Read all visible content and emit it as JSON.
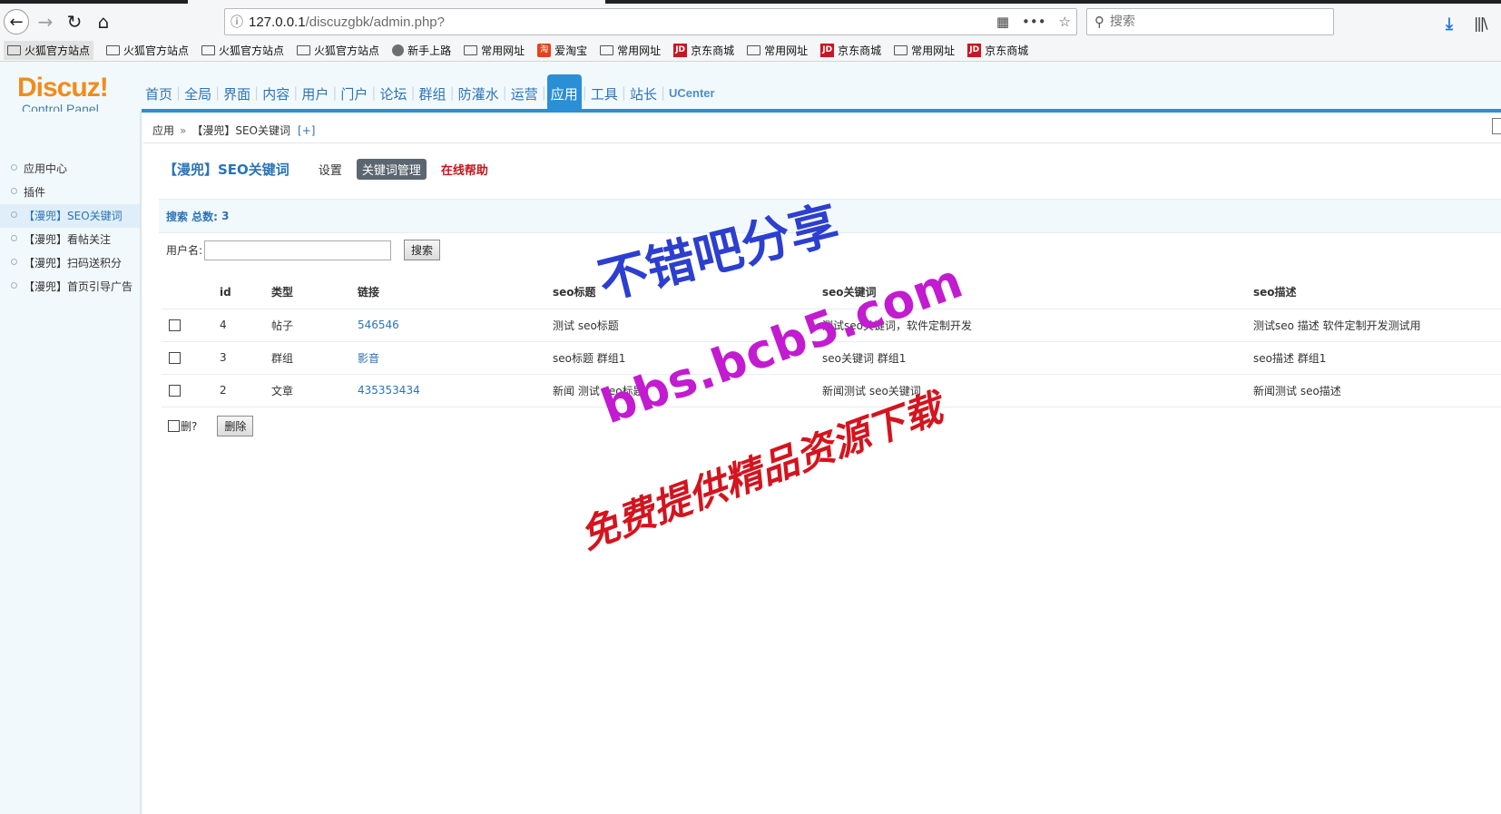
{
  "browser": {
    "url_host": "127.0.0.1",
    "url_path": "/discuzgbk/admin.php?",
    "search_placeholder": "搜索",
    "bookmarks": [
      {
        "label": "火狐官方站点",
        "icon": "folder"
      },
      {
        "label": "火狐官方站点",
        "icon": "folder"
      },
      {
        "label": "火狐官方站点",
        "icon": "folder"
      },
      {
        "label": "火狐官方站点",
        "icon": "folder"
      },
      {
        "label": "新手上路",
        "icon": "globe"
      },
      {
        "label": "常用网址",
        "icon": "folder"
      },
      {
        "label": "爱淘宝",
        "icon": "taobao"
      },
      {
        "label": "常用网址",
        "icon": "folder"
      },
      {
        "label": "京东商城",
        "icon": "jd"
      },
      {
        "label": "常用网址",
        "icon": "folder"
      },
      {
        "label": "京东商城",
        "icon": "jd"
      },
      {
        "label": "常用网址",
        "icon": "folder"
      },
      {
        "label": "京东商城",
        "icon": "jd"
      }
    ]
  },
  "logo": {
    "brand": "Discuz!",
    "sub": "Control Panel"
  },
  "mainnav": {
    "items": [
      "首页",
      "全局",
      "界面",
      "内容",
      "用户",
      "门户",
      "论坛",
      "群组",
      "防灌水",
      "运营",
      "应用",
      "工具",
      "站长",
      "UCenter"
    ],
    "active": "应用"
  },
  "sidebar": {
    "items": [
      "应用中心",
      "插件",
      "【漫兜】SEO关键词",
      "【漫兜】看帖关注",
      "【漫兜】扫码送积分",
      "【漫兜】首页引导广告"
    ],
    "active": "【漫兜】SEO关键词"
  },
  "breadcrumb": {
    "root": "应用",
    "sep": "»",
    "current": "【漫兜】SEO关键词",
    "add": "[+]"
  },
  "page": {
    "title": "【漫兜】SEO关键词",
    "tab_settings": "设置",
    "tab_keywords": "关键词管理",
    "help": "在线帮助"
  },
  "search": {
    "summary_label": "搜索 总数:",
    "total": "3",
    "username_label": "用户名:",
    "username_value": "",
    "button": "搜索"
  },
  "table": {
    "headers": [
      "id",
      "类型",
      "链接",
      "seo标题",
      "seo关键词",
      "seo描述"
    ],
    "rows": [
      {
        "id": "4",
        "type": "帖子",
        "link": "546546",
        "title": "测试 seo标题",
        "keywords": "测试seo关键词，软件定制开发",
        "desc": "测试seo 描述 软件定制开发测试用"
      },
      {
        "id": "3",
        "type": "群组",
        "link": "影音",
        "title": "seo标题 群组1",
        "keywords": "seo关键词 群组1",
        "desc": "seo描述 群组1"
      },
      {
        "id": "2",
        "type": "文章",
        "link": "435353434",
        "title": "新闻 测试 seo标题",
        "keywords": "新闻测试 seo关键词",
        "desc": "新闻测试 seo描述"
      }
    ]
  },
  "footer": {
    "delete_check_label": "删?",
    "delete_button": "删除"
  },
  "watermark": {
    "line1": "不错吧分享",
    "line2": "bbs.bcb5.com",
    "line3": "免费提供精品资源下载"
  }
}
